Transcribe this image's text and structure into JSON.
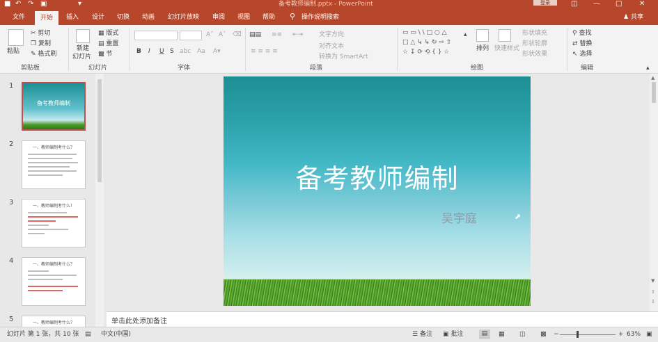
{
  "titlebar": {
    "document_name": "备考教师编制.pptx - PowerPoint",
    "login_label": "登录",
    "qa_icons": [
      "save-icon",
      "undo-icon",
      "redo-icon",
      "presenter-icon",
      "customize-icon"
    ]
  },
  "tabs": {
    "file": "文件",
    "home": "开始",
    "insert": "插入",
    "design": "设计",
    "transitions": "切换",
    "animations": "动画",
    "slideshow": "幻灯片放映",
    "review": "审阅",
    "view": "视图",
    "help": "帮助",
    "tellme": "操作说明搜索",
    "share": "共享"
  },
  "ribbon": {
    "clipboard": {
      "paste": "粘贴",
      "cut": "剪切",
      "copy": "复制",
      "format_painter": "格式刷",
      "label": "剪贴板"
    },
    "slides": {
      "new_slide_line1": "新建",
      "new_slide_line2": "幻灯片",
      "layout": "版式",
      "reset": "重置",
      "section": "节",
      "label": "幻灯片"
    },
    "font": {
      "bold": "B",
      "italic": "I",
      "underline": "U",
      "strike": "S",
      "spacing": "abc",
      "case": "Aa",
      "label": "字体"
    },
    "paragraph": {
      "text_direction": "文字方向",
      "align_text": "对齐文本",
      "convert_smartart": "转换为 SmartArt",
      "label": "段落"
    },
    "drawing": {
      "arrange": "排列",
      "quick_styles": "快速样式",
      "shape_fill": "形状填充",
      "shape_outline": "形状轮廓",
      "shape_effects": "形状效果",
      "label": "绘图"
    },
    "editing": {
      "find": "查找",
      "replace": "替换",
      "select": "选择",
      "label": "编辑"
    }
  },
  "thumbnails": [
    {
      "num": "1",
      "title": "备考教师编制"
    },
    {
      "num": "2",
      "title": "一、教师编制考什么？"
    },
    {
      "num": "3",
      "title": "一、教师编制考什么！"
    },
    {
      "num": "4",
      "title": "一、教师编制考什么？"
    },
    {
      "num": "5",
      "title": "一、教师编制考什么？"
    }
  ],
  "slide": {
    "title": "备考教师编制",
    "author": "吴宇庭"
  },
  "notes": {
    "placeholder": "单击此处添加备注"
  },
  "status": {
    "slide_info": "幻灯片 第 1 张，共 10 张",
    "language": "中文(中国)",
    "notes_btn": "备注",
    "comments_btn": "批注",
    "zoom": "63%",
    "minus": "−",
    "plus": "+"
  },
  "colors": {
    "accent": "#b7472a",
    "ribbon_bg": "#f3f3f3",
    "selection": "#c0504d"
  }
}
